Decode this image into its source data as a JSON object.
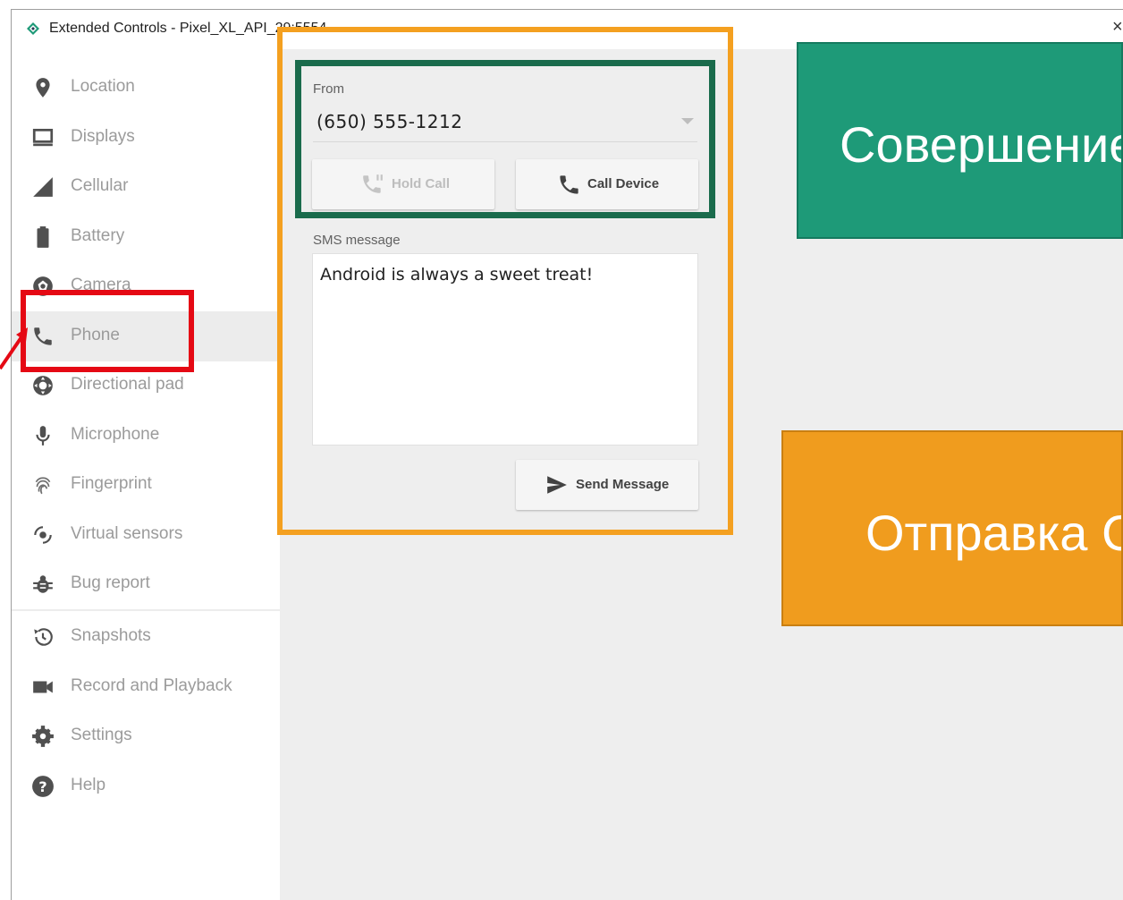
{
  "window": {
    "title": "Extended Controls - Pixel_XL_API_29:5554",
    "close_glyph": "×"
  },
  "sidebar": {
    "items": [
      {
        "label": "Location",
        "icon": "location-pin-icon"
      },
      {
        "label": "Displays",
        "icon": "display-icon"
      },
      {
        "label": "Cellular",
        "icon": "cellular-signal-icon"
      },
      {
        "label": "Battery",
        "icon": "battery-icon"
      },
      {
        "label": "Camera",
        "icon": "camera-aperture-icon"
      },
      {
        "label": "Phone",
        "icon": "phone-icon",
        "active": true
      },
      {
        "label": "Directional pad",
        "icon": "dpad-icon"
      },
      {
        "label": "Microphone",
        "icon": "microphone-icon"
      },
      {
        "label": "Fingerprint",
        "icon": "fingerprint-icon"
      },
      {
        "label": "Virtual sensors",
        "icon": "rotation-icon"
      },
      {
        "label": "Bug report",
        "icon": "bug-icon"
      },
      {
        "label": "Snapshots",
        "icon": "history-icon"
      },
      {
        "label": "Record and Playback",
        "icon": "video-camera-icon"
      },
      {
        "label": "Settings",
        "icon": "gear-icon"
      },
      {
        "label": "Help",
        "icon": "help-icon"
      }
    ]
  },
  "phone": {
    "from_label": "From",
    "from_value": "(650) 555-1212",
    "hold_call_label": "Hold Call",
    "call_device_label": "Call Device",
    "sms_label": "SMS message",
    "sms_value": "Android is always a sweet treat!",
    "send_message_label": "Send Message"
  },
  "callouts": {
    "call_text": "Совершение вызова",
    "sms_text": "Отправка СМС"
  },
  "colors": {
    "callout_green": "#1e9a78",
    "callout_orange": "#f09c1e",
    "highlight_red": "#e50914",
    "highlight_orange": "#f4a020",
    "highlight_green": "#1a6b4c",
    "icon_gray": "#505050"
  }
}
